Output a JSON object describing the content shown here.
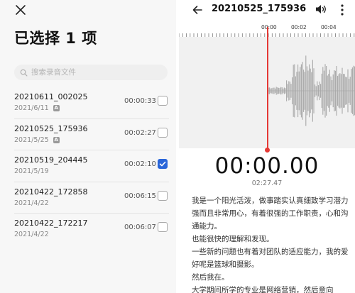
{
  "select_panel": {
    "title": "已选择 1 项",
    "search_placeholder": "搜索录音文件",
    "tag_label": "A",
    "recordings": [
      {
        "name": "20210611_002025",
        "date": "2021/6/11",
        "tagged": true,
        "duration": "00:00:33",
        "checked": false
      },
      {
        "name": "20210525_175936",
        "date": "2021/5/25",
        "tagged": true,
        "duration": "00:02:27",
        "checked": false
      },
      {
        "name": "20210519_204445",
        "date": "2021/5/19",
        "tagged": false,
        "duration": "00:02:10",
        "checked": true
      },
      {
        "name": "20210422_172858",
        "date": "2021/4/22",
        "tagged": false,
        "duration": "00:06:15",
        "checked": false
      },
      {
        "name": "20210422_172217",
        "date": "2021/4/22",
        "tagged": false,
        "duration": "00:06:07",
        "checked": false
      }
    ]
  },
  "player": {
    "title": "20210525_175936",
    "ruler_labels": [
      "00:00",
      "00:02",
      "00:04"
    ],
    "current_time": "00:00.00",
    "total_time": "02:27.47",
    "transcript": [
      "我是一个阳光活泼，做事踏实认真细致学习潜力强而且非常用心，有着很强的工作职责，心和沟通能力。",
      "也能很快的理解和发现。",
      "一些新的问题也有着对团队的适应能力，我的爱好呢是篮球和摄影。",
      "然后我在。",
      "大学期间所学的专业是网络营销，然后意向"
    ]
  },
  "icons": {
    "close": "close-icon",
    "search": "search-icon",
    "back": "arrow-left-icon",
    "volume": "speaker-icon",
    "more": "more-vertical-icon",
    "check": "checkmark-icon"
  },
  "colors": {
    "accent": "#2a66d9",
    "playhead": "#e53935",
    "waveform": "#a8a8a8",
    "left_bg": "#f7f7f7",
    "wave_bg": "#f1f1f1"
  }
}
